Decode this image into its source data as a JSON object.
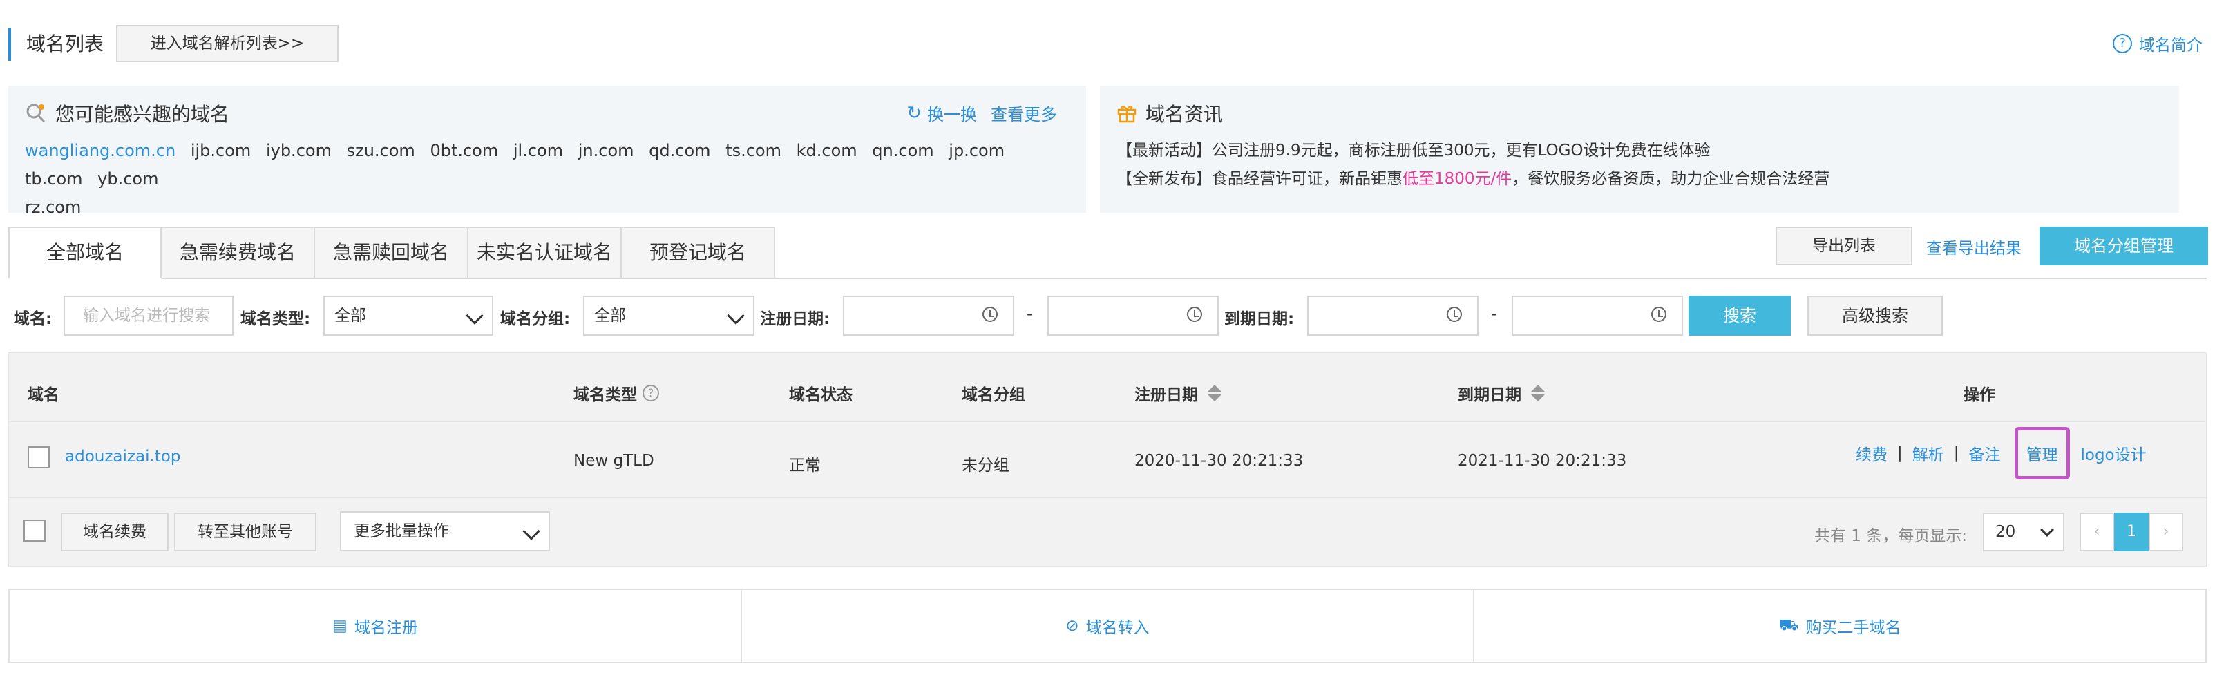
{
  "header": {
    "title": "域名列表",
    "parse_list_button": "进入域名解析列表>>",
    "intro_link": "域名简介",
    "help_glyph": "?"
  },
  "interest_panel": {
    "title": "您可能感兴趣的域名",
    "refresh_label": "换一换",
    "more_label": "查看更多",
    "highlight_domain": "wangliang.com.cn",
    "domains": [
      "ijb.com",
      "iyb.com",
      "szu.com",
      "0bt.com",
      "jl.com",
      "jn.com",
      "qd.com",
      "ts.com",
      "kd.com",
      "qn.com",
      "jp.com",
      "tb.com",
      "yb.com",
      "rz.com"
    ]
  },
  "news_panel": {
    "title": "域名资讯",
    "line1": "【最新活动】公司注册9.9元起，商标注册低至300元，更有LOGO设计免费在线体验",
    "line2_prefix": "【全新发布】食品经营许可证，新品钜惠",
    "line2_highlight": "低至1800元/件",
    "line2_suffix": "，餐饮服务必备资质，助力企业合规合法经营"
  },
  "tabs": [
    "全部域名",
    "急需续费域名",
    "急需赎回域名",
    "未实名认证域名",
    "预登记域名"
  ],
  "toolbar": {
    "export_label": "导出列表",
    "export_result_label": "查看导出结果",
    "group_mgmt_label": "域名分组管理"
  },
  "filters": {
    "domain_label": "域名:",
    "domain_placeholder": "输入域名进行搜索",
    "type_label": "域名类型:",
    "type_value": "全部",
    "group_label": "域名分组:",
    "group_value": "全部",
    "reg_date_label": "注册日期:",
    "expire_date_label": "到期日期:",
    "range_sep": "-",
    "search_label": "搜索",
    "advanced_label": "高级搜索"
  },
  "table": {
    "headers": {
      "domain": "域名",
      "type": "域名类型",
      "status": "域名状态",
      "group": "域名分组",
      "reg_date": "注册日期",
      "expire_date": "到期日期",
      "actions": "操作"
    },
    "rows": [
      {
        "domain": "adouzaizai.top",
        "type": "New gTLD",
        "status": "正常",
        "group": "未分组",
        "reg_date": "2020-11-30 20:21:33",
        "expire_date": "2021-11-30 20:21:33",
        "actions": [
          "续费",
          "解析",
          "备注",
          "管理",
          "logo设计"
        ],
        "action_sep": "|"
      }
    ]
  },
  "bulk": {
    "renew_label": "域名续费",
    "transfer_label": "转至其他账号",
    "more_label": "更多批量操作"
  },
  "pager": {
    "summary": "共有 1 条，每页显示:",
    "page_size": "20",
    "prev": "‹",
    "current": "1",
    "next": "›"
  },
  "quick_links": [
    {
      "icon": "calendar-icon",
      "glyph": "▤",
      "label": "域名注册"
    },
    {
      "icon": "link-icon",
      "glyph": "⊘",
      "label": "域名转入"
    },
    {
      "icon": "cart-icon",
      "glyph": "⛟",
      "label": "购买二手域名"
    }
  ],
  "colors": {
    "accent": "#2a8fd8",
    "primary_button": "#41b8dc",
    "highlight_pink": "#e6399b",
    "manage_outline": "#c257c6"
  }
}
